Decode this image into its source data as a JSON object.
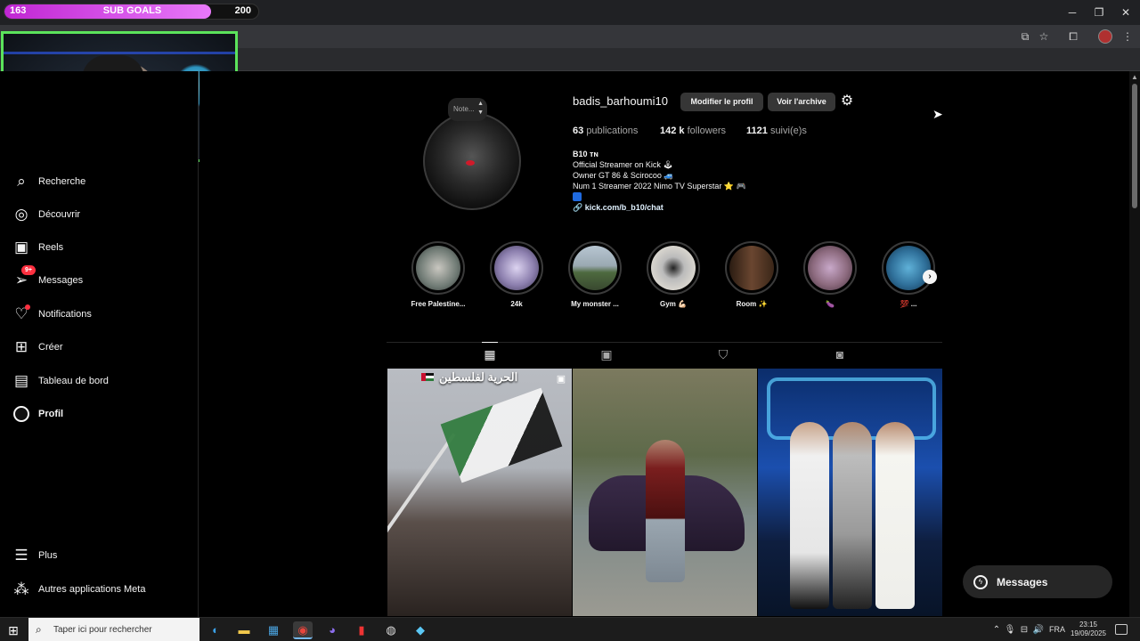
{
  "stream_overlay": {
    "sub_goal_current": "163",
    "sub_goal_title": "SUB GOALS",
    "sub_goal_target": "200",
    "sub_goal_progress": 0.815
  },
  "sidebar": {
    "items": [
      {
        "label": "Recherche",
        "icon": "search-icon"
      },
      {
        "label": "Découvrir",
        "icon": "compass-icon"
      },
      {
        "label": "Reels",
        "icon": "reels-icon"
      },
      {
        "label": "Messages",
        "icon": "messenger-icon",
        "badge": "9+"
      },
      {
        "label": "Notifications",
        "icon": "heart-icon"
      },
      {
        "label": "Créer",
        "icon": "plus-square-icon"
      },
      {
        "label": "Tableau de bord",
        "icon": "dashboard-icon"
      },
      {
        "label": "Profil",
        "icon": "profile-avatar"
      },
      {
        "label": "Plus",
        "icon": "menu-icon"
      },
      {
        "label": "Autres applications Meta",
        "icon": "meta-icon"
      }
    ]
  },
  "profile": {
    "note_placeholder": "Note...",
    "username": "badis_barhoumi10",
    "edit_button": "Modifier le profil",
    "archive_button": "Voir l'archive",
    "publications_count": "63",
    "publications_label": "publications",
    "followers_count": "142 k",
    "followers_label": "followers",
    "following_count": "1121",
    "following_label": "suivi(e)s",
    "bio_name": "B10 ᴛɴ",
    "bio_lines": [
      "Official Streamer on Kick 🕹",
      "Owner GT 86 & Scirocoo 🚙",
      "Num 1 Streamer 2022 Nimo TV Superstar ⭐ 🎮"
    ],
    "bio_link": "kick.com/b_b10/chat"
  },
  "highlights": [
    {
      "label": "Free Palestine..."
    },
    {
      "label": "24k"
    },
    {
      "label": "My monster ..."
    },
    {
      "label": "Gym 💪🏻"
    },
    {
      "label": "Room ✨"
    },
    {
      "label": "🍆"
    },
    {
      "label": "💯 ..."
    }
  ],
  "tabs": [
    "posts-grid-icon",
    "reels-tab-icon",
    "saved-bookmark-icon",
    "tagged-icon"
  ],
  "posts": [
    {
      "caption": "الحرية لفلسطين"
    }
  ],
  "floating_messages": {
    "label": "Messages"
  },
  "taskbar": {
    "search_placeholder": "Taper ici pour rechercher",
    "language": "FRA",
    "time": "23:15",
    "date": "19/09/2025"
  }
}
